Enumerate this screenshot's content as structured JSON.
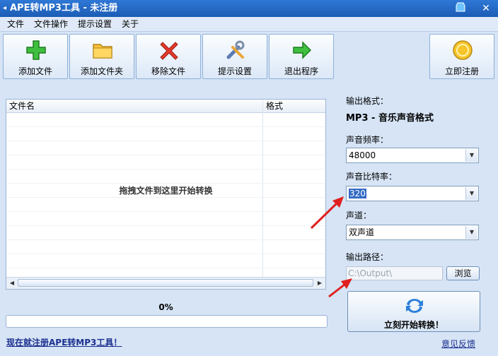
{
  "window": {
    "title": "APE转MP3工具 - 未注册"
  },
  "menu": [
    "文件",
    "文件操作",
    "提示设置",
    "关于"
  ],
  "toolbar": {
    "add_file": "添加文件",
    "add_folder": "添加文件夹",
    "remove_file": "移除文件",
    "prompt_settings": "提示设置",
    "exit": "退出程序",
    "register": "立即注册"
  },
  "file_list": {
    "columns": [
      "文件名",
      "格式"
    ],
    "drop_hint": "拖拽文件到这里开始转换"
  },
  "settings": {
    "output_format_label": "输出格式：",
    "output_format_value": "MP3 - 音乐声音格式",
    "sample_rate_label": "声音频率：",
    "sample_rate_value": "48000",
    "bitrate_label": "声音比特率：",
    "bitrate_value": "320",
    "channel_label": "声道：",
    "channel_value": "双声道",
    "output_path_label": "输出路径：",
    "output_path_value": "C:\\Output\\",
    "browse_label": "浏览"
  },
  "progress": {
    "text": "0%",
    "fraction": 0
  },
  "start_button": {
    "label": "立刻开始转换！"
  },
  "footer": {
    "register_link": "现在就注册APE转MP3工具！",
    "feedback_link": "意见反馈"
  },
  "colors": {
    "titlebar": "#2f78d6",
    "accent": "#4a8bdc",
    "annotation_arrow": "#e02020"
  }
}
